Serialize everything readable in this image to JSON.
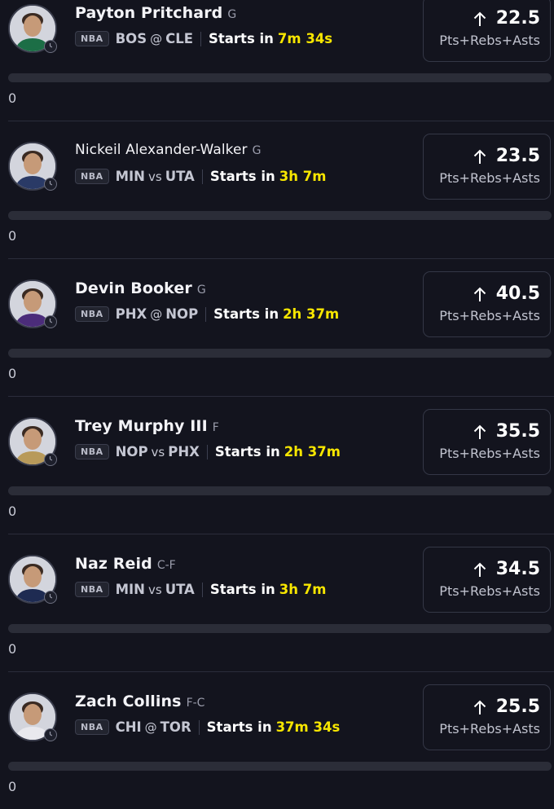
{
  "colors": {
    "background": "#13141e",
    "accent_yellow": "#f7e600",
    "track": "#2b2d38"
  },
  "players": [
    {
      "name": "Payton Pritchard",
      "position": "G",
      "league": "NBA",
      "team_a": "BOS",
      "separator": "@",
      "team_b": "CLE",
      "starts_label": "Starts in",
      "countdown": "7m 34s",
      "line": "22.5",
      "direction_icon": "arrow-up-icon",
      "stat_type": "Pts+Rebs+Asts",
      "progress": 0,
      "count": "0",
      "jersey_color": "#1c6e46"
    },
    {
      "name": "Nickeil Alexander-Walker",
      "position": "G",
      "league": "NBA",
      "team_a": "MIN",
      "separator": "vs",
      "team_b": "UTA",
      "starts_label": "Starts in",
      "countdown": "3h 7m",
      "line": "23.5",
      "direction_icon": "arrow-up-icon",
      "stat_type": "Pts+Rebs+Asts",
      "progress": 0,
      "count": "0",
      "jersey_color": "#2a3a66"
    },
    {
      "name": "Devin Booker",
      "position": "G",
      "league": "NBA",
      "team_a": "PHX",
      "separator": "@",
      "team_b": "NOP",
      "starts_label": "Starts in",
      "countdown": "2h 37m",
      "line": "40.5",
      "direction_icon": "arrow-up-icon",
      "stat_type": "Pts+Rebs+Asts",
      "progress": 0,
      "count": "0",
      "jersey_color": "#4b2c7a"
    },
    {
      "name": "Trey Murphy III",
      "position": "F",
      "league": "NBA",
      "team_a": "NOP",
      "separator": "vs",
      "team_b": "PHX",
      "starts_label": "Starts in",
      "countdown": "2h 37m",
      "line": "35.5",
      "direction_icon": "arrow-up-icon",
      "stat_type": "Pts+Rebs+Asts",
      "progress": 0,
      "count": "0",
      "jersey_color": "#b89a5a"
    },
    {
      "name": "Naz Reid",
      "position": "C-F",
      "league": "NBA",
      "team_a": "MIN",
      "separator": "vs",
      "team_b": "UTA",
      "starts_label": "Starts in",
      "countdown": "3h 7m",
      "line": "34.5",
      "direction_icon": "arrow-up-icon",
      "stat_type": "Pts+Rebs+Asts",
      "progress": 0,
      "count": "0",
      "jersey_color": "#1e2b52"
    },
    {
      "name": "Zach Collins",
      "position": "F-C",
      "league": "NBA",
      "team_a": "CHI",
      "separator": "@",
      "team_b": "TOR",
      "starts_label": "Starts in",
      "countdown": "37m 34s",
      "line": "25.5",
      "direction_icon": "arrow-up-icon",
      "stat_type": "Pts+Rebs+Asts",
      "progress": 0,
      "count": "0",
      "jersey_color": "#e9e9ee"
    }
  ]
}
